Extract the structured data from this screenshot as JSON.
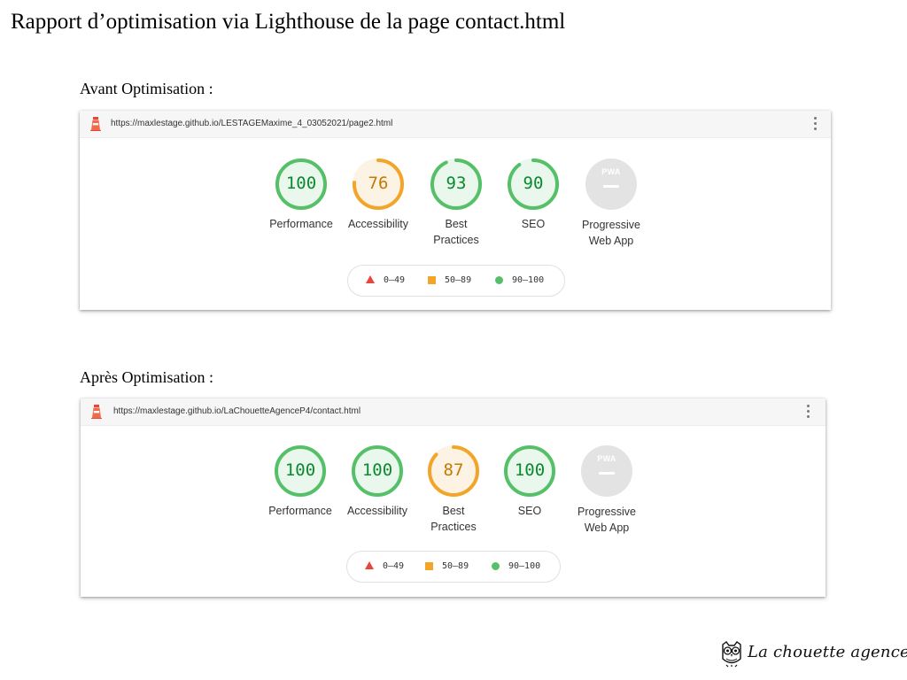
{
  "title": "Rapport d’optimisation via Lighthouse de la page contact.html",
  "colors": {
    "pass": "#55c068",
    "average": "#f2a529",
    "fail": "#e8453c",
    "pwa": "#e3e3e3"
  },
  "reports": [
    {
      "label": "Avant Optimisation :",
      "url": "https://maxlestage.github.io/LESTAGEMaxime_4_03052021/page2.html",
      "gauges": [
        {
          "name": "performance",
          "score": 100,
          "label": "Performance"
        },
        {
          "name": "accessibility",
          "score": 76,
          "label": "Accessibility"
        },
        {
          "name": "best-practices",
          "score": 93,
          "label": "Best Practices"
        },
        {
          "name": "seo",
          "score": 90,
          "label": "SEO"
        }
      ],
      "pwa": {
        "badge": "PWA",
        "label": "Progressive Web App"
      },
      "legend": [
        "0–49",
        "50–89",
        "90–100"
      ]
    },
    {
      "label": "Après Optimisation :",
      "url": "https://maxlestage.github.io/LaChouetteAgenceP4/contact.html",
      "gauges": [
        {
          "name": "performance",
          "score": 100,
          "label": "Performance"
        },
        {
          "name": "accessibility",
          "score": 100,
          "label": "Accessibility"
        },
        {
          "name": "best-practices",
          "score": 87,
          "label": "Best Practices"
        },
        {
          "name": "seo",
          "score": 100,
          "label": "SEO"
        }
      ],
      "pwa": {
        "badge": "PWA",
        "label": "Progressive Web App"
      },
      "legend": [
        "0–49",
        "50–89",
        "90–100"
      ]
    }
  ],
  "brand": {
    "name": "La chouette agence",
    "icon": "owl-icon"
  }
}
